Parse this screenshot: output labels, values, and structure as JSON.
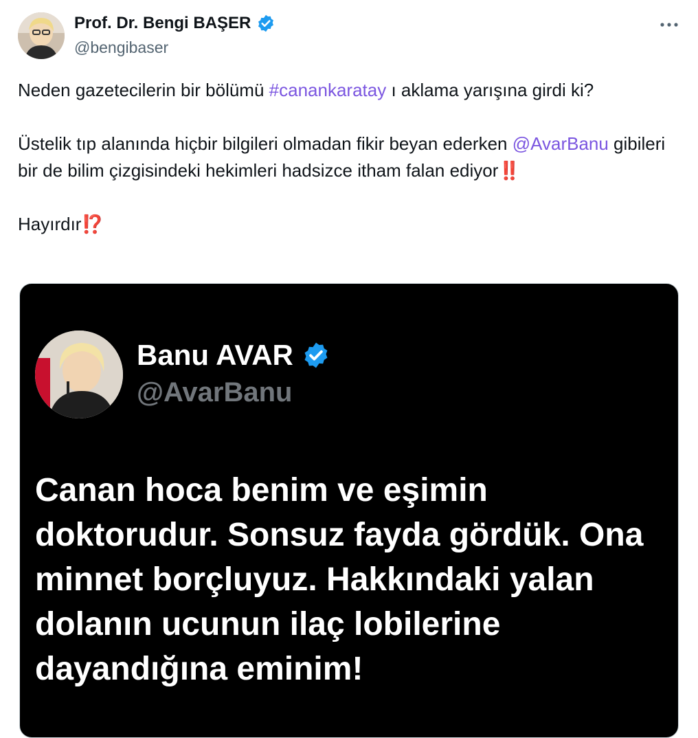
{
  "author": {
    "name": "Prof. Dr. Bengi BAŞER",
    "handle": "@bengibaser",
    "avatar_icon": "profile-photo-icon",
    "verified_icon": "verified-badge-icon"
  },
  "more_icon": "more-options-icon",
  "tweet": {
    "line1_pre": "Neden gazetecilerin bir bölümü ",
    "hashtag": "#canankaratay",
    "line1_post": " ı aklama yarışına girdi ki?",
    "para2_pre": "Üstelik tıp alanında hiçbir bilgileri olmadan fikir beyan ederken ",
    "mention": "@AvarBanu",
    "para2_post": "  gibileri bir de bilim çizgisindeki hekimleri hadsizce itham falan ediyor",
    "emoji1": "‼️",
    "para3": "Hayırdır",
    "emoji2": "⁉️"
  },
  "embedded": {
    "name": "Banu AVAR",
    "handle": "@AvarBanu",
    "avatar_icon": "profile-photo-icon",
    "verified_icon": "verified-badge-icon",
    "text": "Canan hoca benim ve eşimin\ndoktorudur. Sonsuz fayda gördük. Ona\nminnet borçluyuz.   Hakkındaki yalan\ndolanın ucunun  ilaç lobilerine\ndayandığına eminim!"
  },
  "colors": {
    "link": "#7b56e0",
    "verified": "#1d9bf0",
    "handle_gray": "#536471",
    "embed_bg": "#000000"
  }
}
